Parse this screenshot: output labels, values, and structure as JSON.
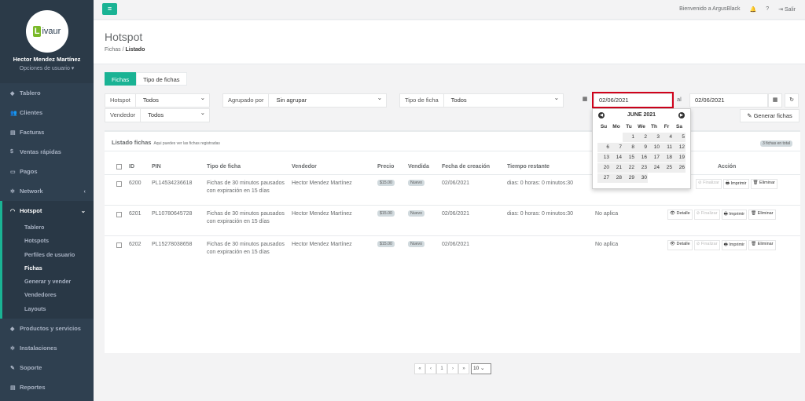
{
  "brand": {
    "logo_letter": "L",
    "logo_text": "ivaur",
    "accent": "#1ab394"
  },
  "user": {
    "name": "Hector Mendez Martínez",
    "options": "Opciones de usuario ▾"
  },
  "nav": [
    {
      "label": "Tablero",
      "icon": "dashboard-icon",
      "glyph": "◆"
    },
    {
      "label": "Clientes",
      "icon": "users-icon",
      "glyph": "👥"
    },
    {
      "label": "Facturas",
      "icon": "file-icon",
      "glyph": "▤"
    },
    {
      "label": "Ventas rápidas",
      "icon": "dollar-icon",
      "glyph": "$"
    },
    {
      "label": "Pagos",
      "icon": "money-icon",
      "glyph": "▭"
    },
    {
      "label": "Network",
      "icon": "network-icon",
      "glyph": "✲"
    },
    {
      "label": "Hotspot",
      "icon": "wifi-icon",
      "glyph": "◠"
    },
    {
      "label": "Productos y servicios",
      "icon": "tag-icon",
      "glyph": "◆"
    },
    {
      "label": "Instalaciones",
      "icon": "gears-icon",
      "glyph": "✲"
    },
    {
      "label": "Soporte",
      "icon": "wrench-icon",
      "glyph": "✎"
    },
    {
      "label": "Reportes",
      "icon": "book-icon",
      "glyph": "▤"
    }
  ],
  "hotspot_sub": [
    "Tablero",
    "Hotspots",
    "Perfiles de usuario",
    "Fichas",
    "Generar y vender",
    "Vendedores",
    "Layouts"
  ],
  "topbar": {
    "menu_glyph": "≡",
    "welcome": "Bienvenido a ArgusBlack",
    "bell": "🔔",
    "help": "?",
    "logout": "⇥ Salir"
  },
  "page": {
    "title": "Hotspot",
    "bc_parent": "Fichas",
    "bc_current": "Listado"
  },
  "tabs": [
    "Fichas",
    "Tipo de fichas"
  ],
  "filters": {
    "hotspot_label": "Hotspot",
    "hotspot_value": "Todos",
    "group_label": "Agrupado por",
    "group_value": "Sin agrupar",
    "type_label": "Tipo de ficha",
    "type_value": "Todos",
    "seller_label": "Vendedor",
    "seller_value": "Todos",
    "date_from": "02/06/2021",
    "date_sep": "al",
    "date_to": "02/06/2021",
    "generate": "✎ Generar fichas"
  },
  "panel": {
    "title": "Listado fichas",
    "subtitle": "Aqui puedes ver las fichas registradas",
    "total": "3 fichas en total"
  },
  "columns": [
    "ID",
    "PIN",
    "Tipo de ficha",
    "Vendedor",
    "Precio",
    "Vendida",
    "Fecha de creación",
    "Tiempo restante",
    "Acción"
  ],
  "rows": [
    {
      "id": "6200",
      "pin": "PL14534236618",
      "type": "Fichas de 30 minutos pausados con expiración en 15 días",
      "seller": "Hector Mendez Martínez",
      "price": "$15.00",
      "sold": "Nuevo",
      "created": "02/06/2021",
      "remaining": "dias: 0 horas: 0 minutos:30",
      "expires": ""
    },
    {
      "id": "6201",
      "pin": "PL10780645728",
      "type": "Fichas de 30 minutos pausados con expiración en 15 días",
      "seller": "Hector Mendez Martínez",
      "price": "$15.00",
      "sold": "Nuevo",
      "created": "02/06/2021",
      "remaining": "dias: 0 horas: 0 minutos:30",
      "expires": "No aplica"
    },
    {
      "id": "6202",
      "pin": "PL15278038658",
      "type": "Fichas de 30 minutos pausados con expiración en 15 días",
      "seller": "Hector Mendez Martínez",
      "price": "$15.00",
      "sold": "Nuevo",
      "created": "02/06/2021",
      "remaining": "",
      "expires": "No aplica"
    }
  ],
  "actions": {
    "detail": "👁 Detalle",
    "finish": "⊘ Finalizar",
    "print": "🖶 Imprimir",
    "delete": "🗑 Eliminar"
  },
  "pager": [
    "«",
    "‹",
    "1",
    "›",
    "»"
  ],
  "page_size": "10 ⌄",
  "calendar": {
    "month": "JUNE 2021",
    "days": [
      "Su",
      "Mo",
      "Tu",
      "We",
      "Th",
      "Fr",
      "Sa"
    ],
    "cells": [
      "",
      "",
      "1",
      "2",
      "3",
      "4",
      "5",
      "6",
      "7",
      "8",
      "9",
      "10",
      "11",
      "12",
      "13",
      "14",
      "15",
      "16",
      "17",
      "18",
      "19",
      "20",
      "21",
      "22",
      "23",
      "24",
      "25",
      "26",
      "27",
      "28",
      "29",
      "30",
      "",
      "",
      ""
    ]
  }
}
